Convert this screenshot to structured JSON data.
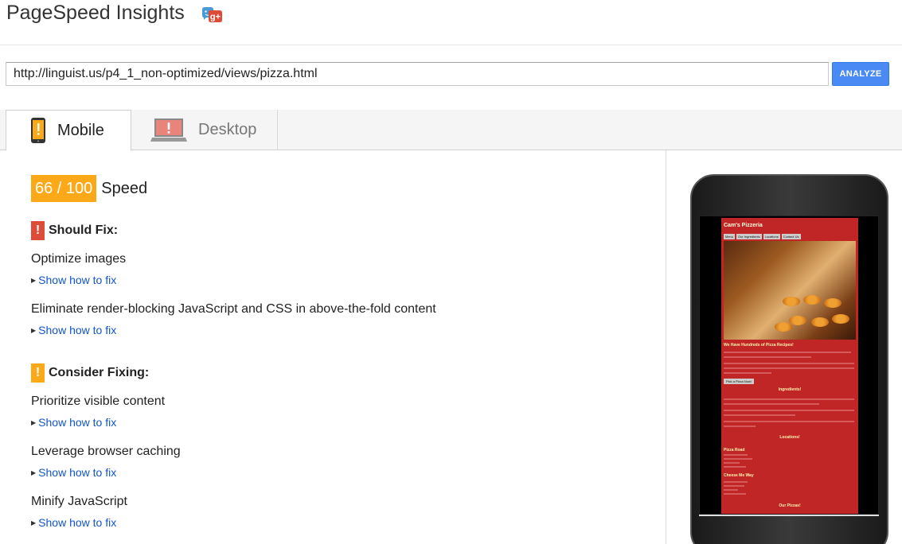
{
  "app": {
    "title": "PageSpeed Insights",
    "gplus_icon": "google-plus-icon"
  },
  "search": {
    "url": "http://linguist.us/p4_1_non-optimized/views/pizza.html",
    "analyze_label": "ANALYZE"
  },
  "tabs": [
    {
      "label": "Mobile",
      "icon": "mobile-phone-icon"
    },
    {
      "label": "Desktop",
      "icon": "desktop-monitor-icon"
    }
  ],
  "score": {
    "value": "66 / 100",
    "label": "Speed"
  },
  "should_fix": {
    "title": "Should Fix:",
    "items": [
      {
        "name": "Optimize images",
        "link": "Show how to fix"
      },
      {
        "name": "Eliminate render-blocking JavaScript and CSS in above-the-fold content",
        "link": "Show how to fix"
      }
    ]
  },
  "consider_fixing": {
    "title": "Consider Fixing:",
    "items": [
      {
        "name": "Prioritize visible content",
        "link": "Show how to fix"
      },
      {
        "name": "Leverage browser caching",
        "link": "Show how to fix"
      },
      {
        "name": "Minify JavaScript",
        "link": "Show how to fix"
      }
    ]
  },
  "preview": {
    "site_title": "Cam's Pizzeria",
    "nav": [
      "Menu",
      "Our Ingredients",
      "Locations",
      "Contact Us"
    ],
    "headline": "We Have Hundreds of Pizza Recipes!",
    "button": "Pick a Pizza Now!",
    "section_ingredients": "Ingredients!",
    "section_locations": "Locations!",
    "location_1": "Pizza Road",
    "location_2": "Cheese Me Way",
    "section_pizzas": "Our Pizzas!"
  },
  "colors": {
    "score": "#fba919",
    "should_fix": "#dd4b39",
    "consider": "#fba919",
    "link": "#1155cc",
    "analyze": "#4a8af4"
  }
}
